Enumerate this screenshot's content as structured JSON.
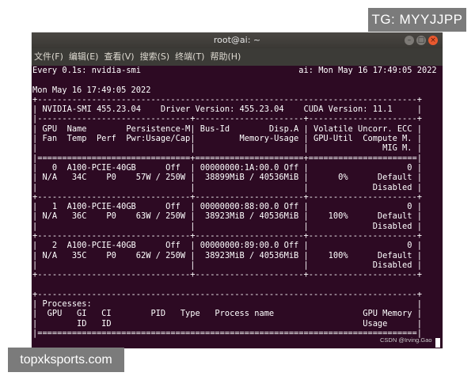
{
  "badges": {
    "top_right": "TG: MYYJJPP",
    "bottom_left": "topxksports.com"
  },
  "window": {
    "title": "root@ai: ~",
    "buttons": {
      "minimize": "–",
      "maximize": "□",
      "close": "×"
    }
  },
  "menu": [
    "文件(F)",
    "编辑(E)",
    "查看(V)",
    "搜索(S)",
    "终端(T)",
    "帮助(H)"
  ],
  "terminal_lines": [
    "Every 0.1s: nvidia-smi                                ai: Mon May 16 17:49:05 2022",
    "",
    "Mon May 16 17:49:05 2022",
    "+-----------------------------------------------------------------------------+",
    "| NVIDIA-SMI 455.23.04    Driver Version: 455.23.04    CUDA Version: 11.1     |",
    "|-------------------------------+----------------------+----------------------+",
    "| GPU  Name        Persistence-M| Bus-Id        Disp.A | Volatile Uncorr. ECC |",
    "| Fan  Temp  Perf  Pwr:Usage/Cap|         Memory-Usage | GPU-Util  Compute M. |",
    "|                               |                      |               MIG M. |",
    "|===============================+======================+======================|",
    "|   0  A100-PCIE-40GB      Off  | 00000000:1A:00.0 Off |                    0 |",
    "| N/A   34C    P0    57W / 250W |  38899MiB / 40536MiB |      0%      Default |",
    "|                               |                      |             Disabled |",
    "+-------------------------------+----------------------+----------------------+",
    "|   1  A100-PCIE-40GB      Off  | 00000000:88:00.0 Off |                    0 |",
    "| N/A   36C    P0    63W / 250W |  38923MiB / 40536MiB |    100%      Default |",
    "|                               |                      |             Disabled |",
    "+-------------------------------+----------------------+----------------------+",
    "|   2  A100-PCIE-40GB      Off  | 00000000:89:00.0 Off |                    0 |",
    "| N/A   35C    P0    62W / 250W |  38923MiB / 40536MiB |    100%      Default |",
    "|                               |                      |             Disabled |",
    "+-------------------------------+----------------------+----------------------+",
    "",
    "+-----------------------------------------------------------------------------+",
    "| Processes:                                                                  |",
    "|  GPU   GI   CI        PID   Type   Process name                  GPU Memory |",
    "|        ID   ID                                                   Usage      |",
    "|=============================================================================|"
  ],
  "csdn_watermark": "CSDN @Irving.Gao"
}
